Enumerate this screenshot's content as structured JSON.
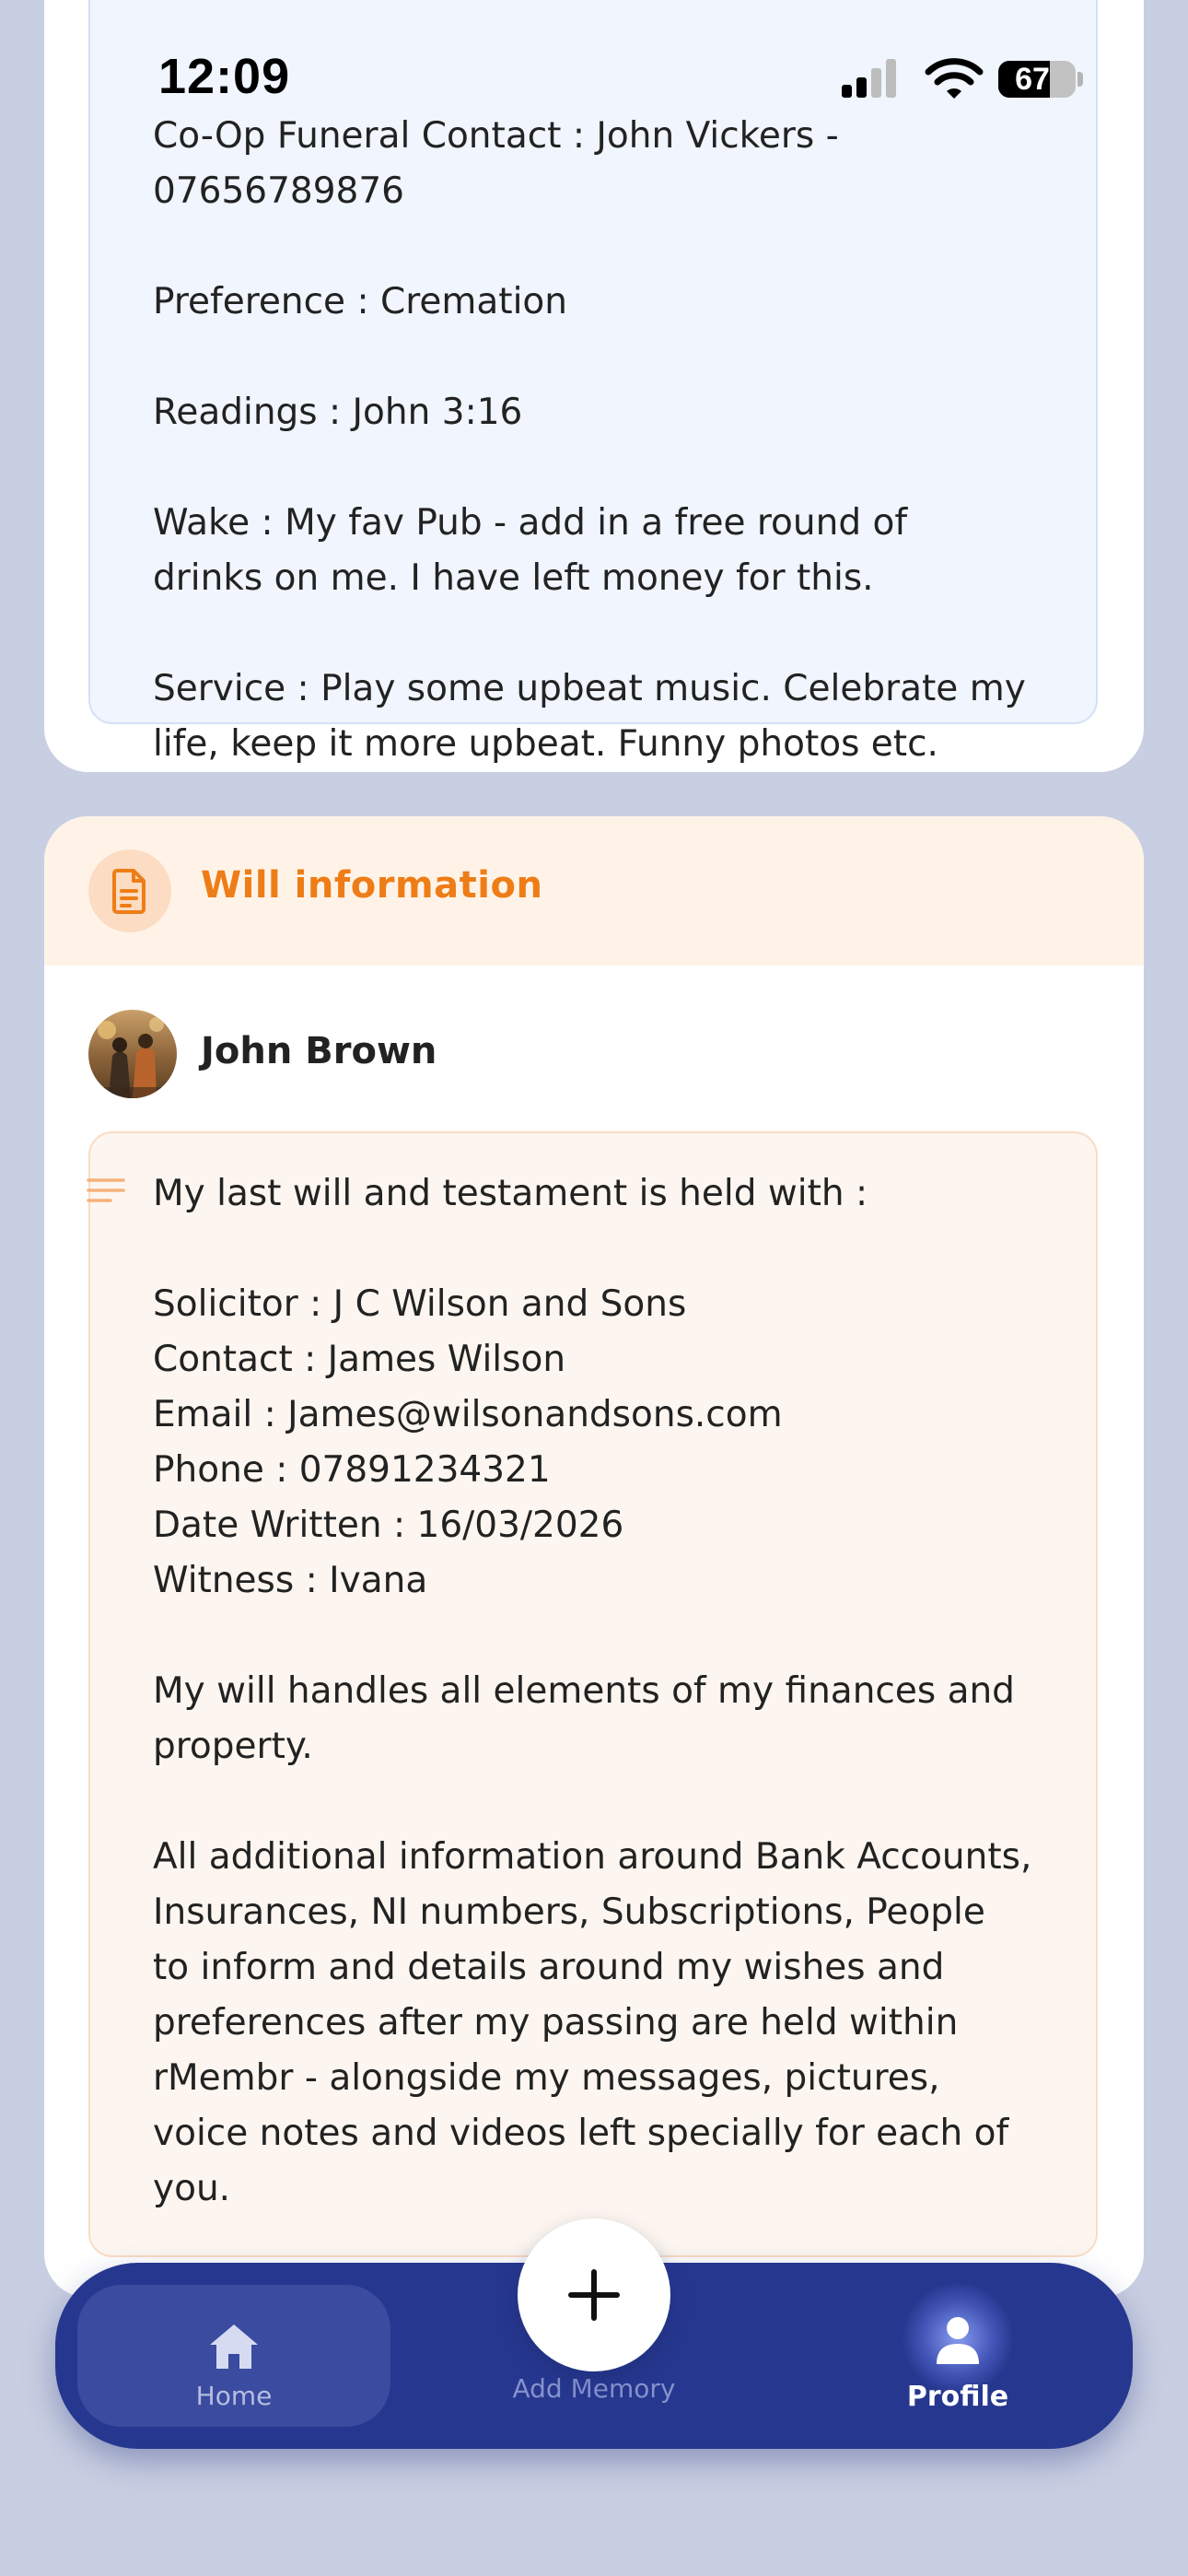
{
  "status_bar": {
    "time": "12:09",
    "battery": "67",
    "battery_level": 0.67,
    "signal_bars": 2,
    "icons": [
      "cellular-signal-icon",
      "wifi-icon",
      "battery-icon"
    ]
  },
  "funeral_card": {
    "text": "Co-Op Funeral Contact : John Vickers -\n07656789876\n\nPreference : Cremation\n\nReadings : John 3:16\n\nWake : My fav Pub - add in a free round of\ndrinks on me. I have left money for this.\n\nService : Play some upbeat music. Celebrate my\nlife, keep it more upbeat. Funny photos etc."
  },
  "will_card": {
    "title": "Will information",
    "icon": "document-icon",
    "author": "John Brown",
    "text": "My last will and testament is held with :\n\nSolicitor : J C Wilson and Sons\nContact : James Wilson\nEmail : James@wilsonandsons.com\nPhone : 07891234321\nDate Written : 16/03/2026\nWitness : Ivana\n\nMy will handles all elements of my finances and\nproperty.\n\nAll additional information around Bank Accounts,\nInsurances, NI numbers, Subscriptions, People\nto inform and details around my wishes and\npreferences after my passing are held within\nrMembr - alongside my messages, pictures,\nvoice notes and videos left specially for each of\nyou."
  },
  "bottom_nav": {
    "home_label": "Home",
    "add_label": "Add Memory",
    "profile_label": "Profile",
    "active": "Profile"
  },
  "colors": {
    "background": "#c9cfe2",
    "accent_orange": "#ee7d17",
    "nav_blue": "#26378f",
    "funeral_box": "#f0f5fe",
    "will_box": "#fdf6f0"
  }
}
